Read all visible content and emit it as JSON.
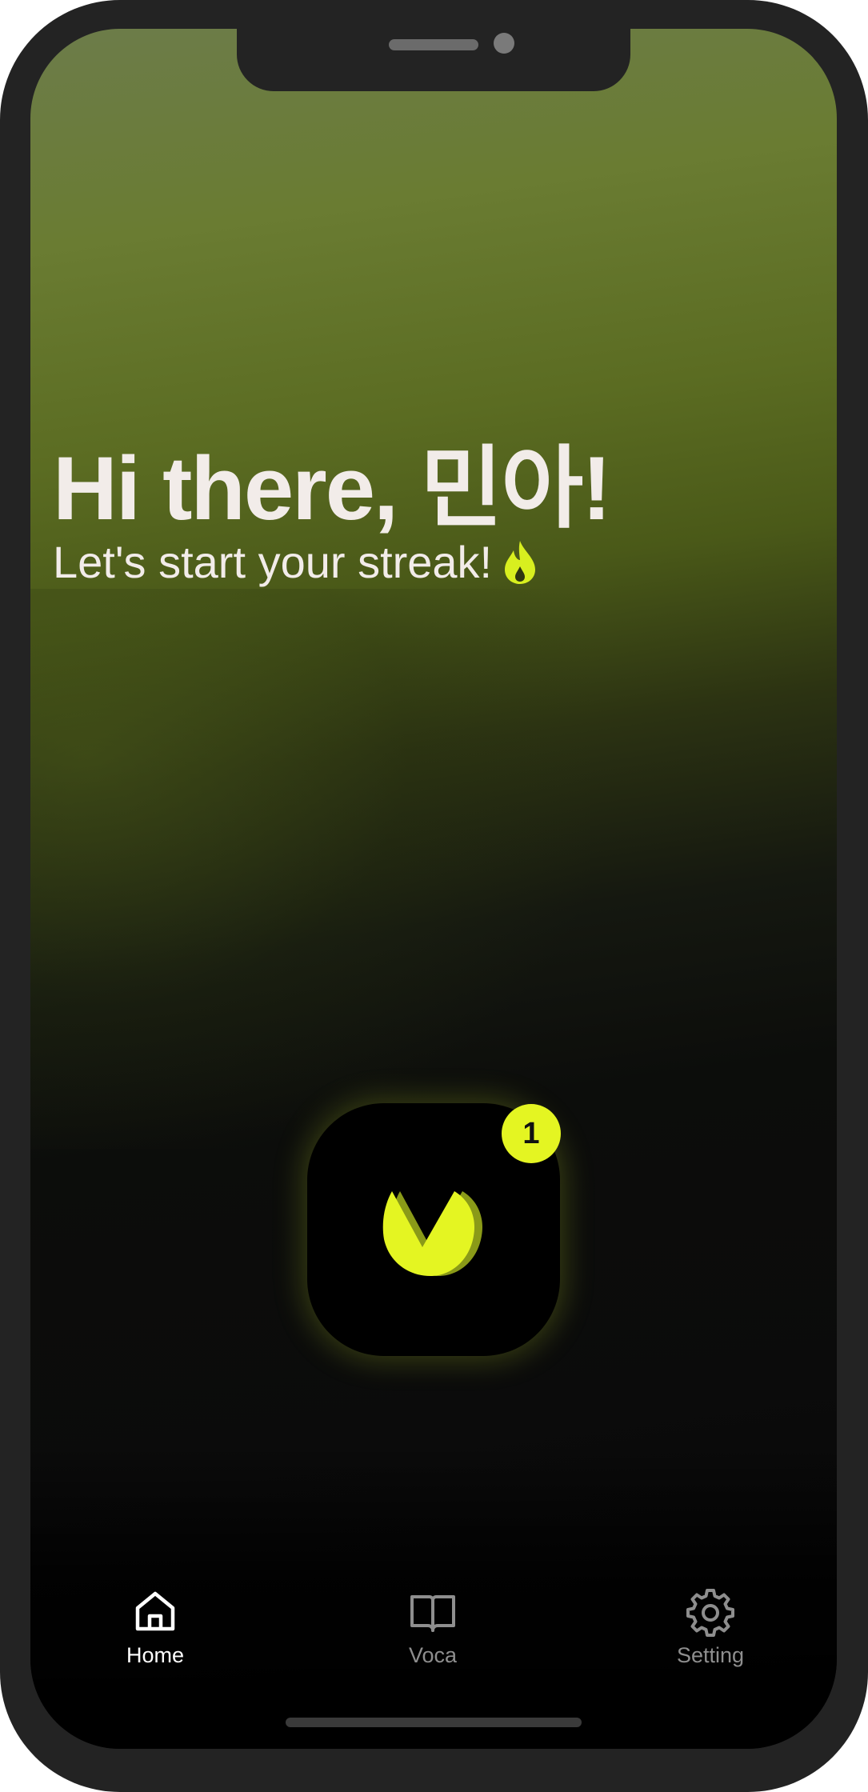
{
  "greeting": {
    "title": "Hi there, 민아!",
    "subtitle": "Let's start your streak!",
    "subtitle_icon": "flame-icon"
  },
  "app": {
    "badge_count": "1",
    "logo_icon": "v-logo-icon",
    "accent_color": "#e4f522"
  },
  "tabbar": {
    "items": [
      {
        "label": "Home",
        "icon": "home-icon",
        "active": true
      },
      {
        "label": "Voca",
        "icon": "book-icon",
        "active": false
      },
      {
        "label": "Setting",
        "icon": "gear-icon",
        "active": false
      }
    ]
  }
}
